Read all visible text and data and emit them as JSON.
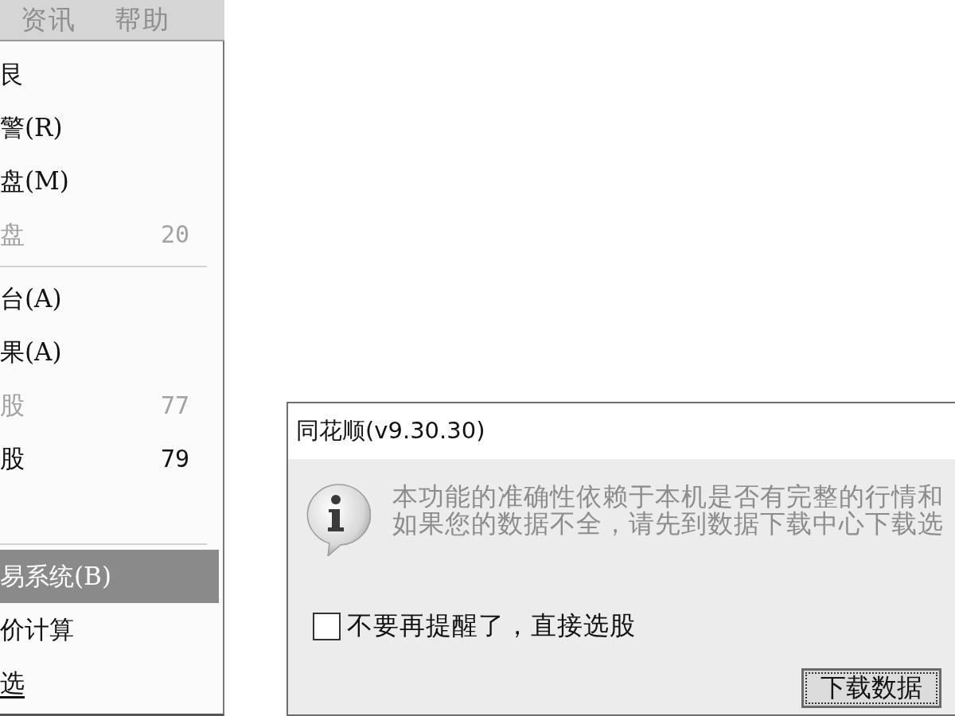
{
  "menu_bar": {
    "items": [
      {
        "label": "资讯"
      },
      {
        "label": "帮助"
      }
    ]
  },
  "dropdown_menu": {
    "items": [
      {
        "kind": "item",
        "label": "艮",
        "selected": false,
        "disabled": false,
        "underlined": false
      },
      {
        "kind": "item",
        "label": "警(R)",
        "selected": false,
        "disabled": false,
        "underlined": false
      },
      {
        "kind": "item",
        "label": "盘(M)",
        "selected": false,
        "disabled": false,
        "underlined": false
      },
      {
        "kind": "item",
        "label": "盘",
        "count": "20",
        "selected": false,
        "disabled": true,
        "underlined": false
      },
      {
        "kind": "separator"
      },
      {
        "kind": "item",
        "label": "台(A)",
        "selected": false,
        "disabled": false,
        "underlined": false
      },
      {
        "kind": "item",
        "label": "果(A)",
        "selected": false,
        "disabled": false,
        "underlined": false
      },
      {
        "kind": "item",
        "label": "股",
        "count": "77",
        "selected": false,
        "disabled": true,
        "underlined": false
      },
      {
        "kind": "item",
        "label": "股",
        "count": "79",
        "selected": false,
        "disabled": false,
        "underlined": false
      },
      {
        "kind": "blank"
      },
      {
        "kind": "separator"
      },
      {
        "kind": "item",
        "label": "易系统(B)",
        "selected": true,
        "disabled": false,
        "underlined": false
      },
      {
        "kind": "item",
        "label": "价计算",
        "selected": false,
        "disabled": false,
        "underlined": false
      },
      {
        "kind": "item",
        "label": "选",
        "selected": false,
        "disabled": false,
        "underlined": true
      }
    ]
  },
  "dialog": {
    "title": "同花顺(v9.30.30)",
    "message_lines": [
      "本功能的准确性依赖于本机是否有完整的行情和",
      "如果您的数据不全，请先到数据下载中心下载选"
    ],
    "checkbox": {
      "label": "不要再提醒了，直接选股",
      "checked": false
    },
    "buttons": [
      {
        "label": "下载数据",
        "default": true
      }
    ]
  }
}
